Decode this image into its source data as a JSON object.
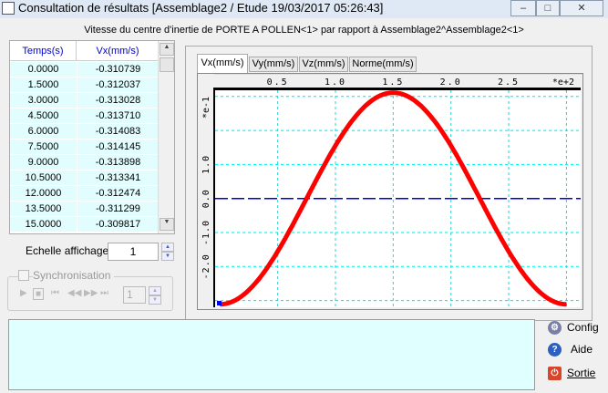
{
  "window": {
    "title": "Consultation de résultats [Assemblage2 / Etude 19/03/2017 05:26:43]"
  },
  "subtitle": "Vitesse du centre d'inertie de PORTE A POLLEN<1> par rapport à Assemblage2^Assemblage2<1>",
  "table": {
    "headers": [
      "Temps(s)",
      "Vx(mm/s)"
    ],
    "rows": [
      [
        "0.0000",
        "-0.310739"
      ],
      [
        "1.5000",
        "-0.312037"
      ],
      [
        "3.0000",
        "-0.313028"
      ],
      [
        "4.5000",
        "-0.313710"
      ],
      [
        "6.0000",
        "-0.314083"
      ],
      [
        "7.5000",
        "-0.314145"
      ],
      [
        "9.0000",
        "-0.313898"
      ],
      [
        "10.5000",
        "-0.313341"
      ],
      [
        "12.0000",
        "-0.312474"
      ],
      [
        "13.5000",
        "-0.311299"
      ],
      [
        "15.0000",
        "-0.309817"
      ]
    ]
  },
  "echelle": {
    "label": "Echelle affichage",
    "value": "1"
  },
  "sync": {
    "label": "Synchronisation",
    "value": "1"
  },
  "tabs": [
    "Vx(mm/s)",
    "Vy(mm/s)",
    "Vz(mm/s)",
    "Norme(mm/s)"
  ],
  "buttons": {
    "config": "Config",
    "aide": "Aide",
    "sortie": "Sortie"
  },
  "chart_data": {
    "type": "line",
    "title": "Vx(mm/s)",
    "x_ticks": [
      "0.5",
      "1.0",
      "1.5",
      "2.0",
      "2.5"
    ],
    "x_multiplier": "*e+2",
    "y_ticks": [
      "-2.0",
      "-1.0",
      "0.0",
      "1.0"
    ],
    "y_multiplier": "*e-1",
    "xlim": [
      0,
      300
    ],
    "ylim": [
      -0.32,
      0.32
    ],
    "series": [
      {
        "name": "Vx",
        "color": "#ff0000",
        "formula_samples": "sinusoid",
        "x": [
          0,
          15,
          30,
          45,
          60,
          75,
          90,
          105,
          120,
          135,
          150,
          165,
          180,
          195,
          210,
          225,
          240,
          255,
          270,
          285,
          300
        ],
        "y": [
          -0.311,
          -0.296,
          -0.252,
          -0.183,
          -0.096,
          0,
          0.096,
          0.183,
          0.252,
          0.296,
          0.311,
          0.296,
          0.252,
          0.183,
          0.096,
          0,
          -0.096,
          -0.183,
          -0.252,
          -0.296,
          -0.311
        ]
      }
    ],
    "grid": true
  }
}
